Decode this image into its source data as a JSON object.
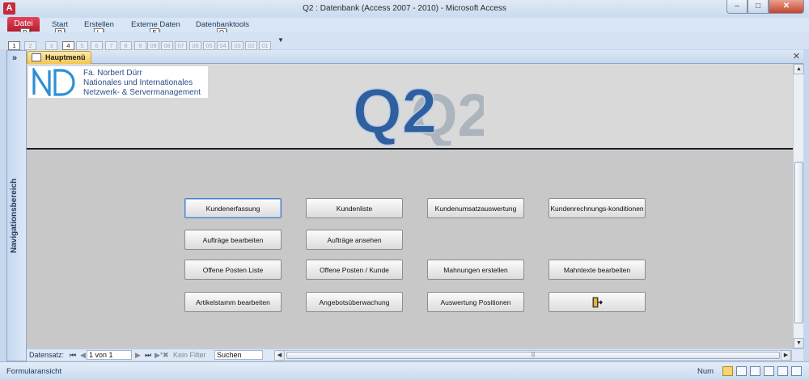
{
  "window": {
    "title": "Q2 : Datenbank (Access 2007 - 2010) - Microsoft Access",
    "app_letter": "A"
  },
  "ribbon": {
    "file_tab": "Datei",
    "tabs": [
      "Start",
      "Erstellen",
      "Externe Daten",
      "Datenbanktools"
    ],
    "key_tips": [
      "D",
      "R",
      "L",
      "E",
      "O"
    ],
    "qat_key_tips": [
      "1",
      "2",
      "3",
      "4",
      "5",
      "6",
      "7",
      "8",
      "9",
      "09",
      "08",
      "07",
      "06",
      "05",
      "04",
      "03",
      "02",
      "01"
    ]
  },
  "nav_pane": {
    "label": "Navigationsbereich",
    "toggle": "»"
  },
  "document_tab": {
    "label": "Hauptmenü"
  },
  "header": {
    "company_lines": [
      "Fa. Norbert Dürr",
      "Nationales und Internationales",
      "Netzwerk- & Servermanagement"
    ],
    "logo_text": "Q2"
  },
  "buttons": {
    "kundenerfassung": "Kundenerfassung",
    "kundenliste": "Kundenliste",
    "kundenumsatz": "Kundenumsatzauswertung",
    "kundenrechnung": "Kundenrechnungs-konditionen",
    "auftraege_bearbeiten": "Aufträge bearbeiten",
    "auftraege_ansehen": "Aufträge ansehen",
    "offene_posten_liste": "Offene Posten Liste",
    "offene_posten_kunde": "Offene Posten / Kunde",
    "mahnungen": "Mahnungen erstellen",
    "mahntexte": "Mahntexte bearbeiten",
    "artikelstamm": "Artikelstamm bearbeiten",
    "angebote": "Angebotsüberwachung",
    "auswertung_pos": "Auswertung Positionen"
  },
  "record_nav": {
    "label": "Datensatz:",
    "position": "1 von 1",
    "filter": "Kein Filter",
    "search_placeholder": "Suchen"
  },
  "status": {
    "left": "Formularansicht",
    "num": "Num"
  },
  "colors": {
    "file_tab": "#c22b3b",
    "doc_tab": "#f4c54c",
    "logo_blue": "#2f5f9e"
  }
}
